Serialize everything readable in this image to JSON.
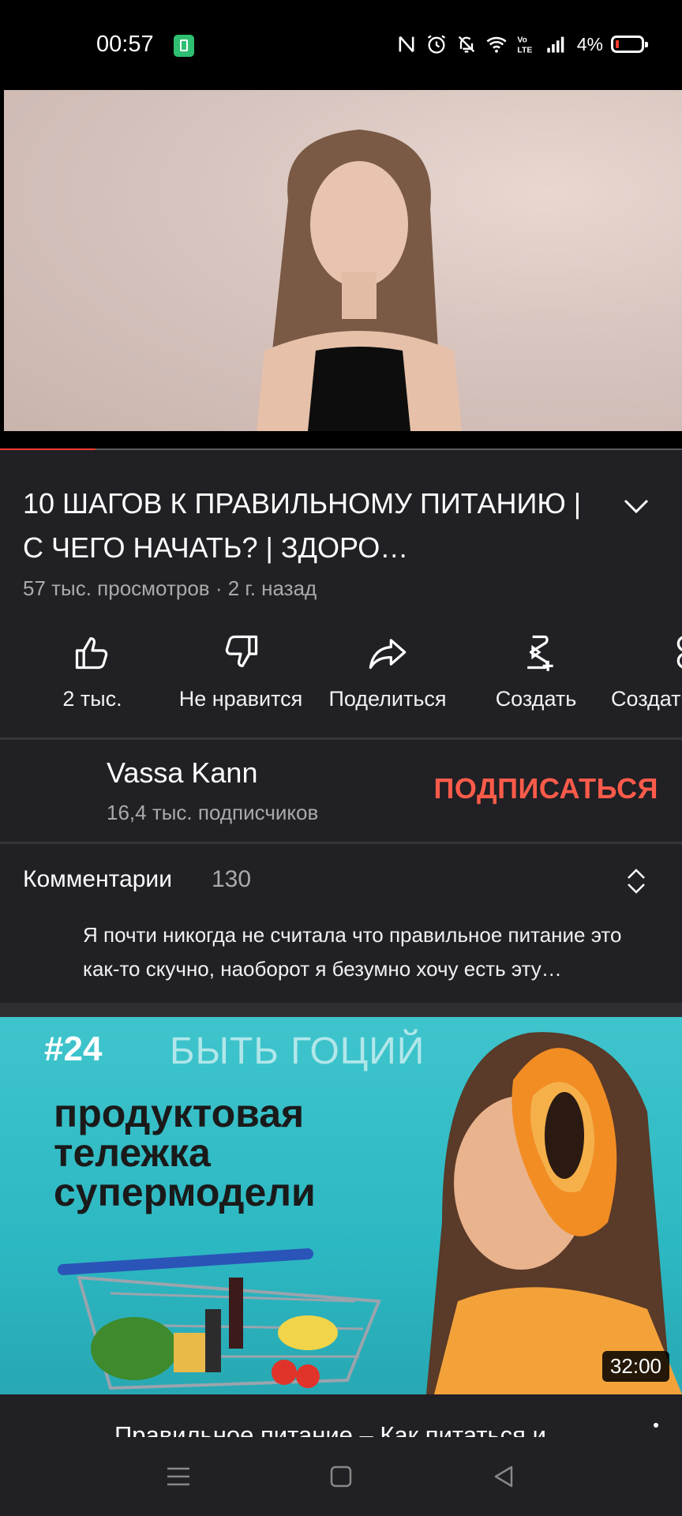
{
  "status_bar": {
    "time": "00:57",
    "battery_pct": "4%"
  },
  "video": {
    "progress_fraction": 0.14
  },
  "title": "10 ШАГОВ К ПРАВИЛЬНОМУ ПИТАНИЮ | С ЧЕГО НАЧАТЬ? | ЗДОРО…",
  "meta": "57 тыс. просмотров · 2 г. назад",
  "actions": [
    {
      "label": "2 тыс.",
      "icon": "thumbs-up-icon"
    },
    {
      "label": "Не нравится",
      "icon": "thumbs-down-icon"
    },
    {
      "label": "Поделиться",
      "icon": "share-icon"
    },
    {
      "label": "Создать",
      "icon": "create-icon"
    },
    {
      "label": "Создат",
      "icon": "remix-icon"
    }
  ],
  "channel": {
    "name": "Vassa Kann",
    "subscribers": "16,4 тыс. подписчиков",
    "subscribe_label": "ПОДПИСАТЬСЯ"
  },
  "comments": {
    "title": "Комментарии",
    "count": "130",
    "top_comment": "Я почти никогда не считала что правильное питание это как-то скучно, наоборот я безумно хочу есть эту…"
  },
  "recommended": {
    "thumb_episode": "#24",
    "thumb_brand": "БЫТЬ ГОЦИЙ",
    "thumb_lines": [
      "продуктовая",
      "тележка",
      "супермодели"
    ],
    "duration": "32:00",
    "next_title": "Правильное питание – Как питаться и"
  },
  "colors": {
    "accent_red": "#ff3b30",
    "subscribe": "#ff5b4a",
    "background": "#212024"
  }
}
